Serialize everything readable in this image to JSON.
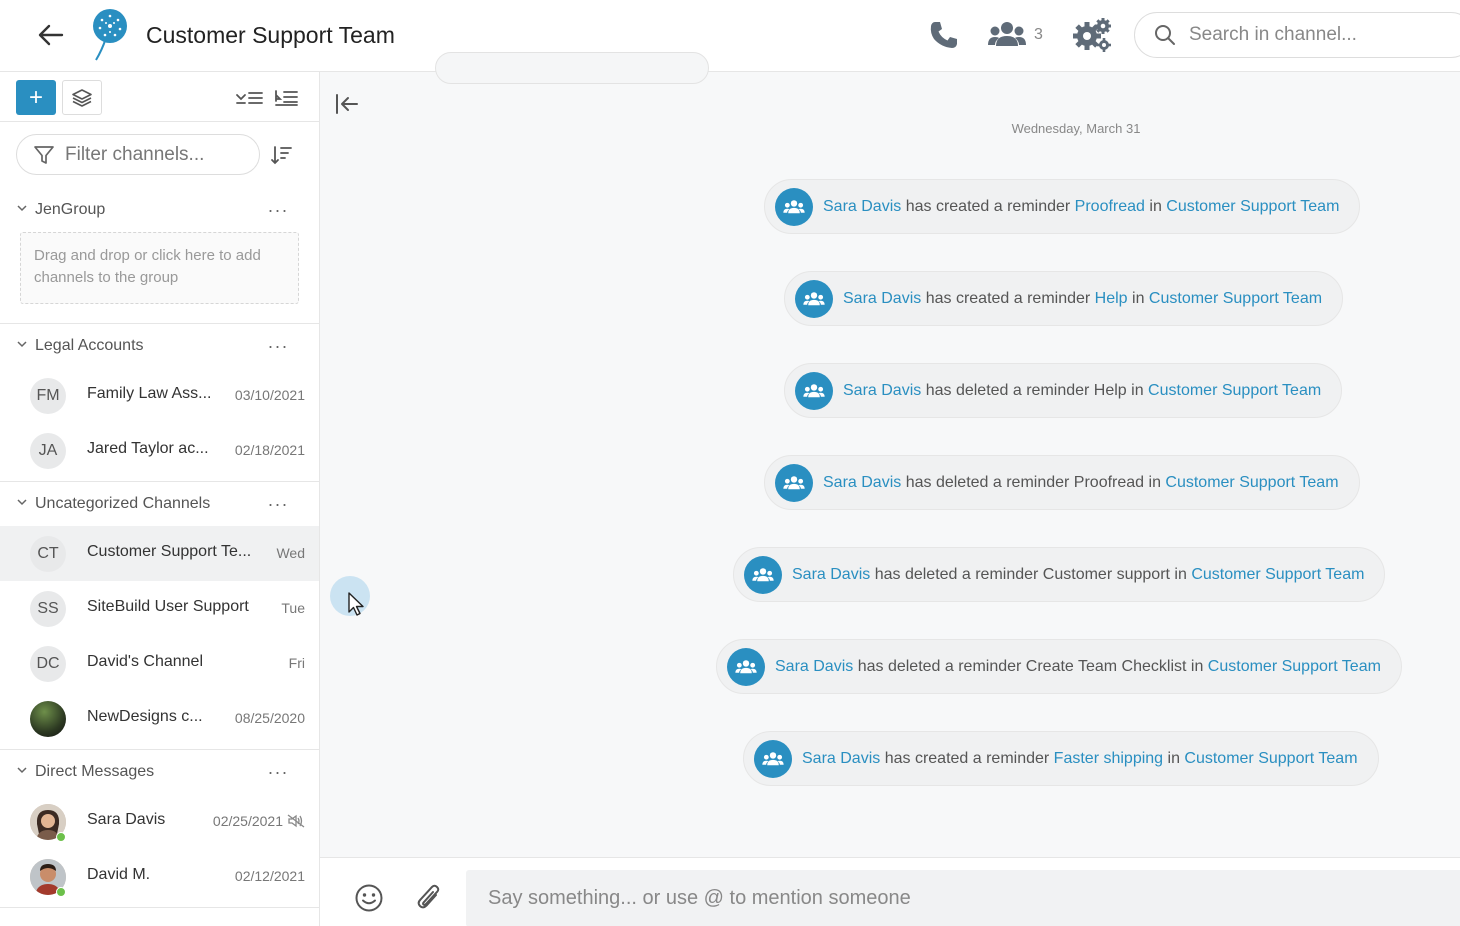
{
  "header": {
    "title": "Customer Support Team",
    "members_count": "3",
    "search_placeholder": "Search in channel..."
  },
  "sidebar": {
    "filter_placeholder": "Filter channels...",
    "groups": [
      {
        "name": "JenGroup",
        "dropzone_text": "Drag and drop or click here to add channels to the group"
      },
      {
        "name": "Legal Accounts",
        "items": [
          {
            "initials": "FM",
            "name": "Family Law Ass...",
            "date": "03/10/2021"
          },
          {
            "initials": "JA",
            "name": "Jared Taylor ac...",
            "date": "02/18/2021"
          }
        ]
      },
      {
        "name": "Uncategorized Channels",
        "items": [
          {
            "initials": "CT",
            "name": "Customer Support Te...",
            "date": "Wed"
          },
          {
            "initials": "SS",
            "name": "SiteBuild User Support",
            "date": "Tue"
          },
          {
            "initials": "DC",
            "name": "David's Channel",
            "date": "Fri"
          },
          {
            "initials": "",
            "name": "NewDesigns c...",
            "date": "08/25/2020"
          }
        ]
      },
      {
        "name": "Direct Messages",
        "items": [
          {
            "name": "Sara Davis",
            "date": "02/25/2021"
          },
          {
            "name": "David M.",
            "date": "02/12/2021"
          }
        ]
      }
    ]
  },
  "chat": {
    "date_separator": "Wednesday, March 31",
    "messages": [
      {
        "user": "Sara Davis",
        "action": " has created a reminder ",
        "reminder": "Proofread",
        "in": " in ",
        "channel": "Customer Support Team"
      },
      {
        "user": "Sara Davis",
        "action": " has created a reminder ",
        "reminder": "Help",
        "in": " in ",
        "channel": "Customer Support Team"
      },
      {
        "user": "Sara Davis",
        "action": " has deleted a reminder Help in ",
        "channel": "Customer Support Team"
      },
      {
        "user": "Sara Davis",
        "action": " has deleted a reminder Proofread in ",
        "channel": "Customer Support Team"
      },
      {
        "user": "Sara Davis",
        "action": " has deleted a reminder Customer support in ",
        "channel": "Customer Support Team"
      },
      {
        "user": "Sara Davis",
        "action": " has deleted a reminder Create Team Checklist in ",
        "channel": "Customer Support Team"
      },
      {
        "user": "Sara Davis",
        "action": " has created a reminder ",
        "reminder": "Faster shipping",
        "in": " in ",
        "channel": "Customer Support Team"
      }
    ],
    "composer_placeholder": "Say something... or use @ to mention someone"
  },
  "colors": {
    "accent": "#2a8fc1",
    "online": "#6cc04a"
  },
  "icons": [
    "back-arrow-icon",
    "dandelion-logo-icon",
    "phone-icon",
    "users-icon",
    "settings-gears-icon",
    "search-icon",
    "plus-icon",
    "layers-icon",
    "collapse-all-icon",
    "expand-all-icon",
    "filter-icon",
    "sort-icon",
    "chevron-down-icon",
    "more-icon",
    "muted-icon",
    "collapse-sidebar-icon",
    "team-icon",
    "emoji-icon",
    "paperclip-icon"
  ]
}
